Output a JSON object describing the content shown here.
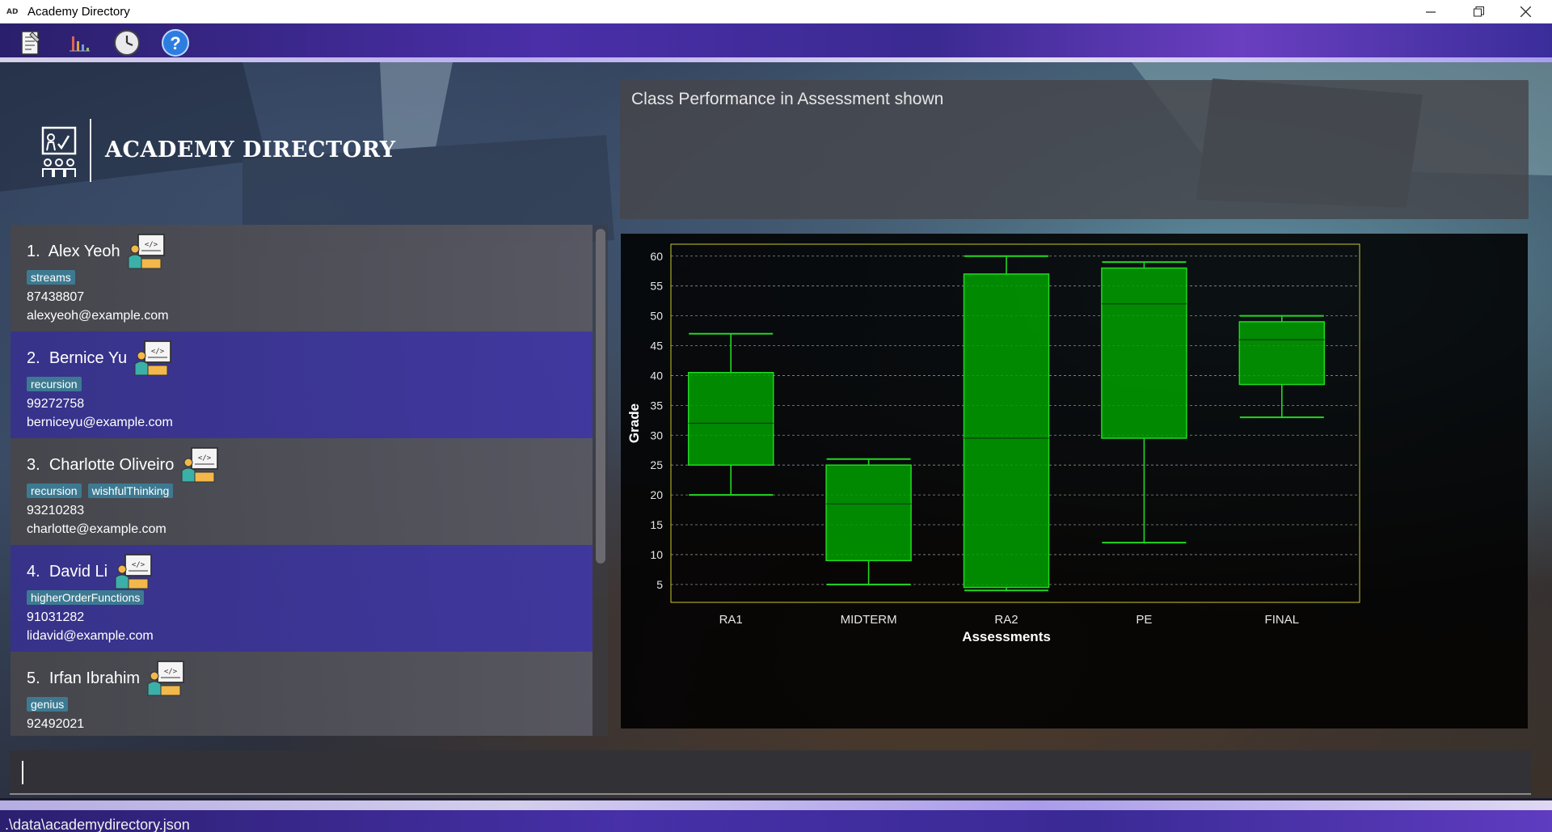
{
  "window": {
    "title": "Academy Directory",
    "icon_text": "AD"
  },
  "toolbar": {
    "buttons": [
      "view-notes-icon",
      "bar-chart-icon",
      "history-clock-icon",
      "help-question-icon"
    ]
  },
  "logo": {
    "text": "ACADEMY DIRECTORY"
  },
  "students": [
    {
      "index": "1.",
      "name": "Alex Yeoh",
      "tags": [
        "streams"
      ],
      "phone": "87438807",
      "email": "alexyeoh@example.com"
    },
    {
      "index": "2.",
      "name": "Bernice Yu",
      "tags": [
        "recursion"
      ],
      "phone": "99272758",
      "email": "berniceyu@example.com"
    },
    {
      "index": "3.",
      "name": "Charlotte Oliveiro",
      "tags": [
        "recursion",
        "wishfulThinking"
      ],
      "phone": "93210283",
      "email": "charlotte@example.com"
    },
    {
      "index": "4.",
      "name": "David Li",
      "tags": [
        "higherOrderFunctions"
      ],
      "phone": "91031282",
      "email": "lidavid@example.com"
    },
    {
      "index": "5.",
      "name": "Irfan Ibrahim",
      "tags": [
        "genius"
      ],
      "phone": "92492021",
      "email": ""
    }
  ],
  "result_display": {
    "text": "Class Performance in Assessment shown"
  },
  "command_box": {
    "value": ""
  },
  "status_bar": {
    "path": ".\\data\\academydirectory.json"
  },
  "colors": {
    "box_fill": "#00a000",
    "box_stroke": "#22d822",
    "tag": "#3d7a92",
    "card_even": "#4232a0"
  },
  "chart_data": {
    "type": "box",
    "xlabel": "Assessments",
    "ylabel": "Grade",
    "ylim": [
      2,
      62
    ],
    "yticks": [
      5,
      10,
      15,
      20,
      25,
      30,
      35,
      40,
      45,
      50,
      55,
      60
    ],
    "grid": "horizontal dashed",
    "categories": [
      "RA1",
      "MIDTERM",
      "RA2",
      "PE",
      "FINAL"
    ],
    "boxes": [
      {
        "label": "RA1",
        "min": 20,
        "q1": 25,
        "median": 32,
        "q3": 40.5,
        "max": 47
      },
      {
        "label": "MIDTERM",
        "min": 5,
        "q1": 9,
        "median": 18.5,
        "q3": 25,
        "max": 26
      },
      {
        "label": "RA2",
        "min": 4,
        "q1": 4.5,
        "median": 29.5,
        "q3": 57,
        "max": 60
      },
      {
        "label": "PE",
        "min": 12,
        "q1": 29.5,
        "median": 52,
        "q3": 58,
        "max": 59
      },
      {
        "label": "FINAL",
        "min": 33,
        "q1": 38.5,
        "median": 46,
        "q3": 49,
        "max": 50
      }
    ]
  }
}
